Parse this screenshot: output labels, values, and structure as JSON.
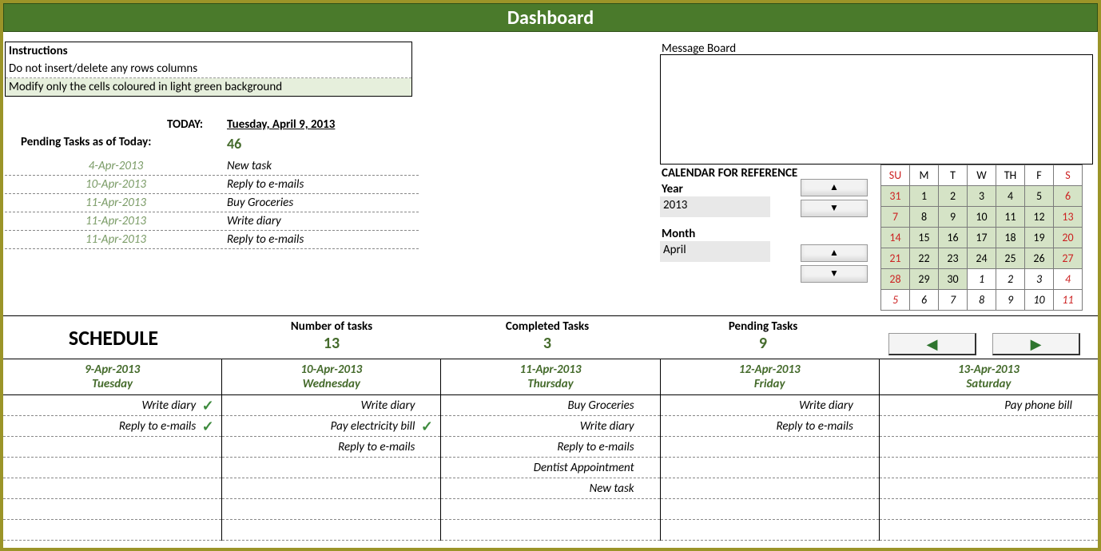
{
  "title": "Dashboard",
  "instructions": {
    "heading": "Instructions",
    "line1": "Do not insert/delete any rows columns",
    "line2": "Modify only the cells coloured in light green background"
  },
  "today": {
    "label": "TODAY:",
    "value": "Tuesday, April 9, 2013"
  },
  "pending": {
    "label": "Pending Tasks as of Today:",
    "value": "46"
  },
  "pending_list": [
    {
      "date": "4-Apr-2013",
      "task": "New task"
    },
    {
      "date": "10-Apr-2013",
      "task": "Reply to e-mails"
    },
    {
      "date": "11-Apr-2013",
      "task": "Buy Groceries"
    },
    {
      "date": "11-Apr-2013",
      "task": "Write diary"
    },
    {
      "date": "11-Apr-2013",
      "task": "Reply to e-mails"
    }
  ],
  "message_board": {
    "title": "Message Board"
  },
  "calendar_ref": {
    "heading": "CALENDAR FOR REFERENCE",
    "year_label": "Year",
    "year_value": "2013",
    "month_label": "Month",
    "month_value": "April"
  },
  "mini_calendar": {
    "headers": [
      "SU",
      "M",
      "T",
      "W",
      "TH",
      "F",
      "S"
    ],
    "rows": [
      [
        {
          "d": "31",
          "in": true,
          "w": true
        },
        {
          "d": "1",
          "in": true
        },
        {
          "d": "2",
          "in": true
        },
        {
          "d": "3",
          "in": true
        },
        {
          "d": "4",
          "in": true
        },
        {
          "d": "5",
          "in": true
        },
        {
          "d": "6",
          "in": true,
          "w": true
        }
      ],
      [
        {
          "d": "7",
          "in": true,
          "w": true
        },
        {
          "d": "8",
          "in": true
        },
        {
          "d": "9",
          "in": true
        },
        {
          "d": "10",
          "in": true
        },
        {
          "d": "11",
          "in": true
        },
        {
          "d": "12",
          "in": true
        },
        {
          "d": "13",
          "in": true,
          "w": true
        }
      ],
      [
        {
          "d": "14",
          "in": true,
          "w": true
        },
        {
          "d": "15",
          "in": true
        },
        {
          "d": "16",
          "in": true
        },
        {
          "d": "17",
          "in": true
        },
        {
          "d": "18",
          "in": true
        },
        {
          "d": "19",
          "in": true
        },
        {
          "d": "20",
          "in": true,
          "w": true
        }
      ],
      [
        {
          "d": "21",
          "in": true,
          "w": true
        },
        {
          "d": "22",
          "in": true
        },
        {
          "d": "23",
          "in": true
        },
        {
          "d": "24",
          "in": true
        },
        {
          "d": "25",
          "in": true
        },
        {
          "d": "26",
          "in": true
        },
        {
          "d": "27",
          "in": true,
          "w": true
        }
      ],
      [
        {
          "d": "28",
          "in": true,
          "w": true
        },
        {
          "d": "29",
          "in": true
        },
        {
          "d": "30",
          "in": true
        },
        {
          "d": "1",
          "in": false
        },
        {
          "d": "2",
          "in": false
        },
        {
          "d": "3",
          "in": false
        },
        {
          "d": "4",
          "in": false,
          "w": true
        }
      ],
      [
        {
          "d": "5",
          "in": false,
          "w": true
        },
        {
          "d": "6",
          "in": false
        },
        {
          "d": "7",
          "in": false
        },
        {
          "d": "8",
          "in": false
        },
        {
          "d": "9",
          "in": false
        },
        {
          "d": "10",
          "in": false
        },
        {
          "d": "11",
          "in": false,
          "w": true
        }
      ]
    ]
  },
  "stats": {
    "schedule_label": "SCHEDULE",
    "number_of_tasks": {
      "label": "Number of tasks",
      "value": "13"
    },
    "completed_tasks": {
      "label": "Completed Tasks",
      "value": "3"
    },
    "pending_tasks": {
      "label": "Pending Tasks",
      "value": "9"
    }
  },
  "nav": {
    "prev": "◀",
    "next": "▶"
  },
  "schedule": [
    {
      "date": "9-Apr-2013",
      "day": "Tuesday",
      "tasks": [
        {
          "t": "Write diary",
          "done": true
        },
        {
          "t": "Reply to e-mails",
          "done": true
        }
      ]
    },
    {
      "date": "10-Apr-2013",
      "day": "Wednesday",
      "tasks": [
        {
          "t": "Write diary",
          "done": false
        },
        {
          "t": "Pay electricity bill",
          "done": true
        },
        {
          "t": "Reply to e-mails",
          "done": false
        }
      ]
    },
    {
      "date": "11-Apr-2013",
      "day": "Thursday",
      "tasks": [
        {
          "t": "Buy Groceries",
          "done": false
        },
        {
          "t": "Write diary",
          "done": false
        },
        {
          "t": "Reply to e-mails",
          "done": false
        },
        {
          "t": "Dentist Appointment",
          "done": false
        },
        {
          "t": "New task",
          "done": false
        }
      ]
    },
    {
      "date": "12-Apr-2013",
      "day": "Friday",
      "tasks": [
        {
          "t": "Write diary",
          "done": false
        },
        {
          "t": "Reply to e-mails",
          "done": false
        }
      ]
    },
    {
      "date": "13-Apr-2013",
      "day": "Saturday",
      "tasks": [
        {
          "t": "Pay phone bill",
          "done": false
        }
      ]
    }
  ],
  "check_mark": "✓"
}
